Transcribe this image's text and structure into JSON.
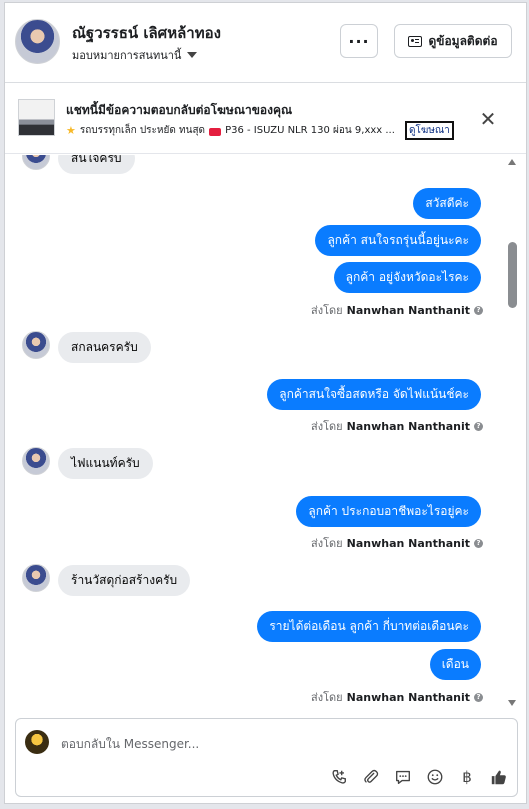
{
  "header": {
    "contact_name": "ณัฐวรรธน์ เลิศหล้าทอง",
    "assign_label": "มอบหมายการสนทนานี้",
    "more_label": "···",
    "contact_info_label": "ดูข้อมูลติดต่อ"
  },
  "ad_banner": {
    "title": "แชทนี้มีข้อความตอบกลับต่อโฆษณาของคุณ",
    "subtitle_pre": "รถบรรทุกเล็ก ประหยัด ทนสุด",
    "subtitle_post": "P36 - ISUZU NLR 130 ผ่อน 9,xxx ...",
    "view_ad_label": "ดูโฆษณา",
    "close_label": "✕"
  },
  "messages": [
    {
      "dir": "in",
      "text": "สนใจครับ"
    },
    {
      "dir": "out",
      "text": "สวัสดีค่ะ"
    },
    {
      "dir": "out",
      "text": "ลูกค้า สนใจรถรุ่นนี้อยู่นะคะ"
    },
    {
      "dir": "out",
      "text": "ลูกค้า อยู่จังหวัดอะไรคะ"
    },
    {
      "dir": "sentby",
      "prefix": "ส่งโดย",
      "name": "Nanwhan Nanthanit"
    },
    {
      "dir": "in",
      "text": "สกลนครครับ"
    },
    {
      "dir": "out",
      "text": "ลูกค้าสนใจซื้อสดหรือ จัดไฟแน้นช์คะ"
    },
    {
      "dir": "sentby",
      "prefix": "ส่งโดย",
      "name": "Nanwhan Nanthanit"
    },
    {
      "dir": "in",
      "text": "ไฟแนนท์ครับ"
    },
    {
      "dir": "out",
      "text": "ลูกค้า ประกอบอาชีพอะไรอยู่คะ"
    },
    {
      "dir": "sentby",
      "prefix": "ส่งโดย",
      "name": "Nanwhan Nanthanit"
    },
    {
      "dir": "in",
      "text": "ร้านวัสดุก่อสร้างครับ"
    },
    {
      "dir": "out",
      "text": "รายได้ต่อเดือน ลูกค้า กี่บาทต่อเดือนคะ"
    },
    {
      "dir": "out",
      "text": "เดือน"
    },
    {
      "dir": "sentby",
      "prefix": "ส่งโดย",
      "name": "Nanwhan Nanthanit"
    }
  ],
  "composer": {
    "placeholder": "ตอบกลับใน Messenger...",
    "tools": [
      "call-icon",
      "attach-icon",
      "saved-reply-icon",
      "emoji-icon",
      "baht-icon",
      "like-icon"
    ]
  },
  "colors": {
    "outgoing_bubble": "#0a7cff",
    "incoming_bubble": "#e9ebee",
    "muted_text": "#65676b"
  }
}
